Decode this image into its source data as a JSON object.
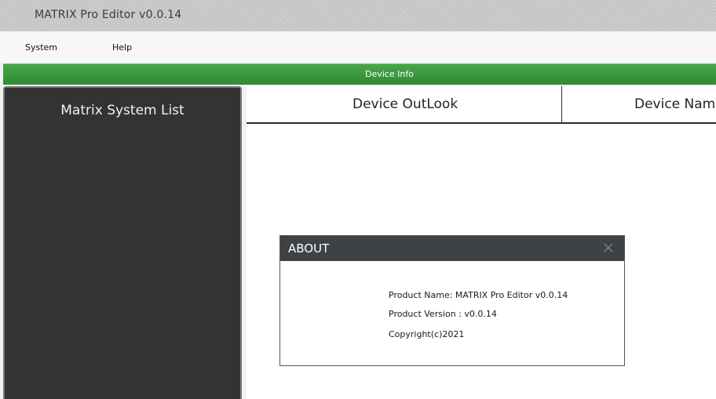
{
  "window": {
    "title": "MATRIX Pro Editor v0.0.14"
  },
  "menubar": {
    "items": [
      {
        "label": "System"
      },
      {
        "label": "Help"
      }
    ]
  },
  "section_bar": {
    "label": "Device Info",
    "color": "#3a9a3e"
  },
  "sidebar": {
    "heading": "Matrix System List"
  },
  "tabs": [
    {
      "label": "Device OutLook"
    },
    {
      "label": "Device Nam"
    }
  ],
  "about_dialog": {
    "title": "ABOUT",
    "close_icon": "close-icon",
    "product_name_line": "Product Name: MATRIX Pro Editor v0.0.14",
    "product_version_line": "Product Version : v0.0.14",
    "copyright_line": "Copyright(c)2021"
  }
}
